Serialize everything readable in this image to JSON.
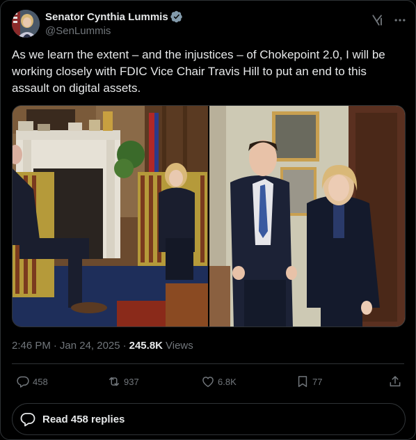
{
  "author": {
    "name": "Senator Cynthia Lummis",
    "handle": "@SenLummis",
    "verified_color": "#829aab"
  },
  "tweet": {
    "text": "As we learn the extent – and the injustices – of Chokepoint 2.0, I will be working closely with FDIC Vice Chair Travis Hill to put an end to this assault on digital assets.",
    "time": "2:46 PM",
    "date": "Jan 24, 2025",
    "views_count": "245.8K",
    "views_label": "Views"
  },
  "actions": {
    "replies": "458",
    "reposts": "937",
    "likes": "6.8K",
    "bookmarks": "77"
  },
  "read_replies": {
    "label": "Read 458 replies"
  },
  "colors": {
    "background": "#000000",
    "text": "#e7e9ea",
    "muted": "#71767b",
    "border": "#2f3336"
  }
}
